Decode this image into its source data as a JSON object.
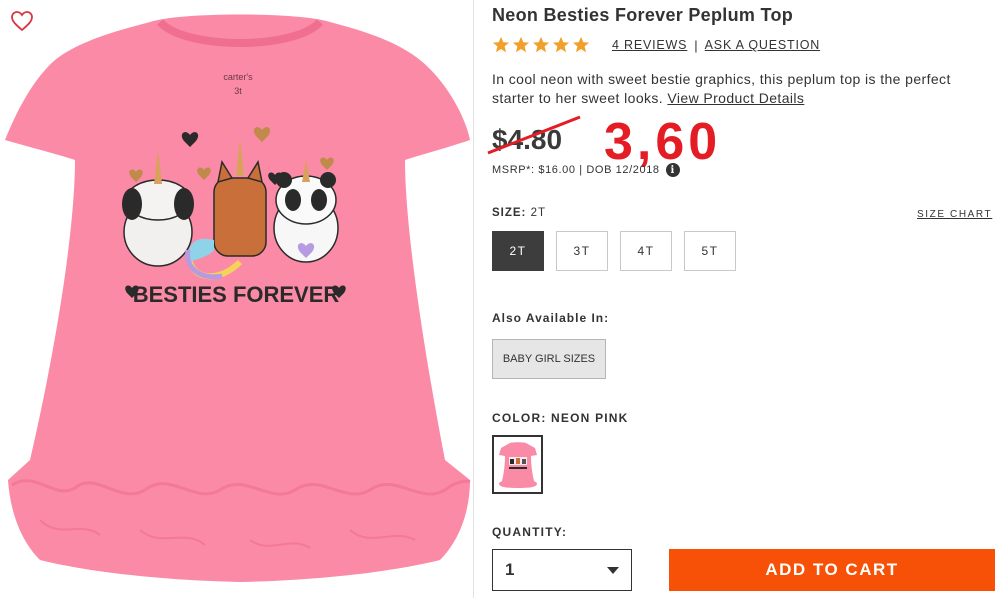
{
  "product": {
    "title": "Neon Besties Forever Peplum Top",
    "rating": 5,
    "rating_max": 5,
    "reviews_label": "4 REVIEWS",
    "separator": "|",
    "ask_label": "ASK A QUESTION",
    "description": "In cool neon with sweet bestie graphics, this peplum top is the perfect starter to her sweet looks.",
    "view_details_label": "View Product Details",
    "image_alt": "BESTIES FOREVER",
    "tag_brand": "carter's",
    "tag_size": "3t"
  },
  "price": {
    "old": "$4.80",
    "new": "3,60",
    "msrp": "MSRP*: $16.00 | DOB 12/2018",
    "info_glyph": "i"
  },
  "size": {
    "label": "SIZE:",
    "selected": "2T",
    "chart_label": "SIZE CHART",
    "options": [
      "2T",
      "3T",
      "4T",
      "5T"
    ]
  },
  "also": {
    "label": "Also Available In:",
    "button": "BABY GIRL SIZES"
  },
  "color": {
    "label": "COLOR: NEON PINK",
    "swatch_color": "#f98ba7"
  },
  "quantity": {
    "label": "QUANTITY:",
    "value": "1"
  },
  "cart": {
    "label": "ADD TO CART",
    "color": "#f75007"
  },
  "colors": {
    "star": "#f2a02a",
    "accent_price": "#e41c24",
    "shirt": "#fb8aa6"
  }
}
